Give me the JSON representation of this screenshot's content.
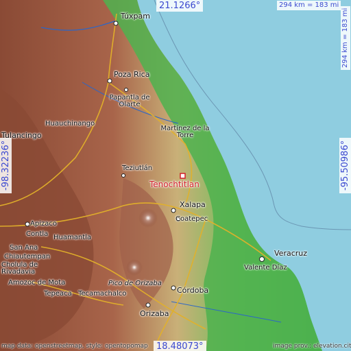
{
  "map": {
    "target": {
      "name": "Tenochtitlan"
    },
    "coords": {
      "top_lat": "21.1266°",
      "bottom_lat": "18.48073°",
      "left_lon": "-98.32236°",
      "right_lon": "-95.50986°",
      "scale_top": "294 km = 183 mi",
      "scale_right": "294 km = 183 mi"
    },
    "attribution": {
      "left": "map data: openstreetmap, style: opentopomap",
      "right": "image prov.: elevation.city"
    },
    "places": [
      "Túxpam",
      "Poza Rica",
      "Papantla de Olarte",
      "Huauchinango",
      "Tulancingo",
      "Martínez de la Torre",
      "Teziutlán",
      "Xalapa",
      "Coatepec",
      "Apizaco",
      "Contla",
      "Huamantla",
      "San Ana",
      "Chiautempan",
      "Cholula de Rivadavia",
      "Amozoc de Mota",
      "Tepeaca",
      "Tecamachalco",
      "Pico de Orizaba",
      "Córdoba",
      "Orizaba",
      "Veracruz",
      "Valente Díaz"
    ]
  },
  "colors": {
    "sea": "#8fcde0",
    "lowland": "#3fae4b",
    "highland": "#b07050",
    "target": "#d3202a",
    "coord_text": "#3a48d0"
  }
}
